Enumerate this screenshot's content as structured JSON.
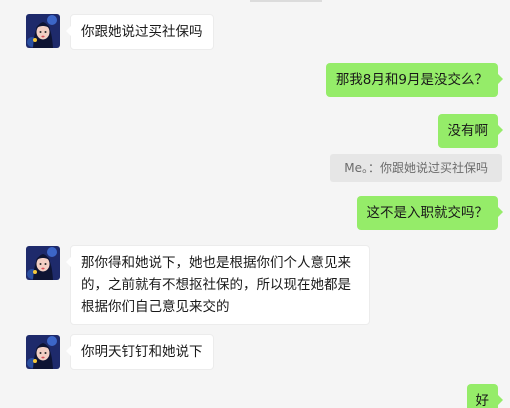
{
  "messages": [
    {
      "sender": "other",
      "text": "你跟她说过买社保吗"
    },
    {
      "sender": "me",
      "text": "那我8月和9月是没交么？"
    },
    {
      "sender": "me",
      "text": "没有啊"
    },
    {
      "sender": "me",
      "text": "这不是入职就交吗？"
    },
    {
      "sender": "other",
      "line1": "那你得和她说下，她也是根据你们个人意见来",
      "line2": "的，之前就有不想抠社保的，所以现在她都是",
      "line3": "根据你们自己意见来交的"
    },
    {
      "sender": "other",
      "text": "你明天钉钉和她说下"
    },
    {
      "sender": "me",
      "text": "好"
    }
  ],
  "quote": {
    "text": "Me。：你跟她说过买社保吗"
  },
  "colors": {
    "background": "#f5f5f5",
    "self_bubble": "#95ec69",
    "other_bubble": "#ffffff",
    "quote_bg": "#e6e6e6"
  }
}
